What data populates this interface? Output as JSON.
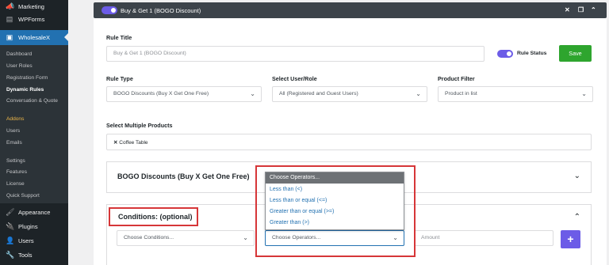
{
  "sidebar": {
    "top_items": [
      {
        "label": "Marketing",
        "icon": "megaphone-icon"
      },
      {
        "label": "WPForms",
        "icon": "form-icon"
      },
      {
        "label": "WholesaleX",
        "icon": "wholesalex-icon"
      }
    ],
    "submenu": [
      {
        "label": "Dashboard"
      },
      {
        "label": "User Roles"
      },
      {
        "label": "Registration Form"
      },
      {
        "label": "Dynamic Rules"
      },
      {
        "label": "Conversation & Quote"
      },
      {
        "label": "Addons"
      },
      {
        "label": "Users"
      },
      {
        "label": "Emails"
      },
      {
        "label": "Settings"
      },
      {
        "label": "Features"
      },
      {
        "label": "License"
      },
      {
        "label": "Quick Support"
      }
    ],
    "bottom_items": [
      {
        "label": "Appearance",
        "icon": "brush-icon"
      },
      {
        "label": "Plugins",
        "icon": "plug-icon"
      },
      {
        "label": "Users",
        "icon": "user-icon"
      },
      {
        "label": "Tools",
        "icon": "wrench-icon"
      }
    ]
  },
  "rule_header": {
    "title": "Buy & Get 1 (BOGO Discount)",
    "enabled": true
  },
  "form": {
    "rule_title_label": "Rule Title",
    "rule_title_value": "Buy & Get 1 (BOGO Discount)",
    "rule_status_label": "Rule Status",
    "save_label": "Save",
    "rule_type_label": "Rule Type",
    "rule_type_value": "BOGO Discounts (Buy X Get One Free)",
    "user_role_label": "Select User/Role",
    "user_role_value": "All (Registered and Guest Users)",
    "product_filter_label": "Product Filter",
    "product_filter_value": "Product in list",
    "multiple_products_label": "Select Multiple Products",
    "selected_products": [
      "Coffee Table"
    ]
  },
  "bogo_section": {
    "title": "BOGO Discounts (Buy X Get One Free)"
  },
  "conditions": {
    "title": "Conditions: (optional)",
    "conditions_placeholder": "Choose Conditions...",
    "operators_placeholder": "Choose Operators...",
    "amount_placeholder": "Amount",
    "add_label": "+"
  },
  "operator_dropdown": {
    "header": "Choose Operators...",
    "options": [
      "Less than (<)",
      "Less than or equal (<=)",
      "Greater than or equal (>=)",
      "Greater than (>)"
    ]
  },
  "colors": {
    "sidebar_bg": "#1d2327",
    "active_menu": "#2271b1",
    "toggle": "#6c5ce7",
    "save_button": "#2ea52e",
    "highlight": "#d63638"
  }
}
